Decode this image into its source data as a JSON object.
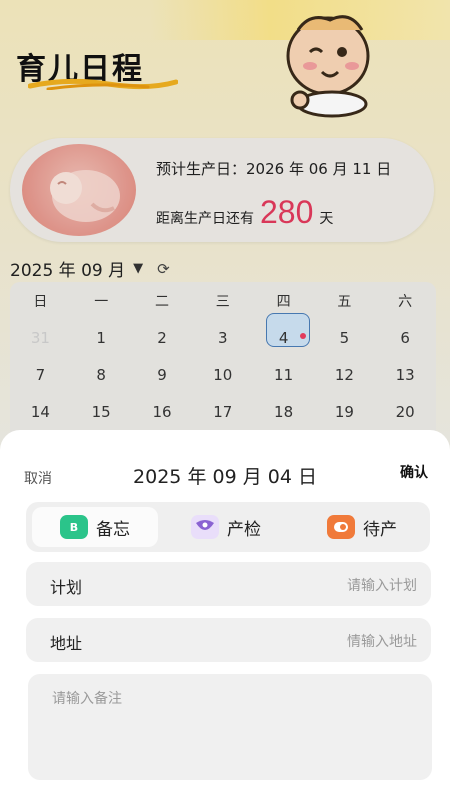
{
  "header": {
    "title": "育儿日程"
  },
  "due": {
    "label": "预计生产日：",
    "date": "2026 年 06 月 11 日",
    "countdown_prefix": "距离生产日还有",
    "days": "280",
    "days_suffix": "天"
  },
  "calendar": {
    "month_label": "2025 年 09 月",
    "weekdays": [
      "日",
      "一",
      "二",
      "三",
      "四",
      "五",
      "六"
    ],
    "rows": [
      [
        "31",
        "1",
        "2",
        "3",
        "4",
        "5",
        "6"
      ],
      [
        "7",
        "8",
        "9",
        "10",
        "11",
        "12",
        "13"
      ],
      [
        "14",
        "15",
        "16",
        "17",
        "18",
        "19",
        "20"
      ]
    ],
    "selected_day": "4",
    "muted_day": "31"
  },
  "sheet": {
    "cancel": "取消",
    "date": "2025 年 09 月 04 日",
    "confirm": "确认",
    "tabs": [
      {
        "label": "备忘",
        "icon": "memo-icon",
        "icon_text": "B",
        "color": "#2bc48a"
      },
      {
        "label": "产检",
        "icon": "checkup-icon",
        "color": "#8a63d2"
      },
      {
        "label": "待产",
        "icon": "labor-icon",
        "color": "#f07a3a"
      }
    ],
    "plan_label": "计划",
    "plan_placeholder": "请输入计划",
    "address_label": "地址",
    "address_placeholder": "情输入地址",
    "memo_placeholder": "请输入备注"
  },
  "colors": {
    "accent": "#e23a5c",
    "selected_border": "#4a7db8"
  }
}
